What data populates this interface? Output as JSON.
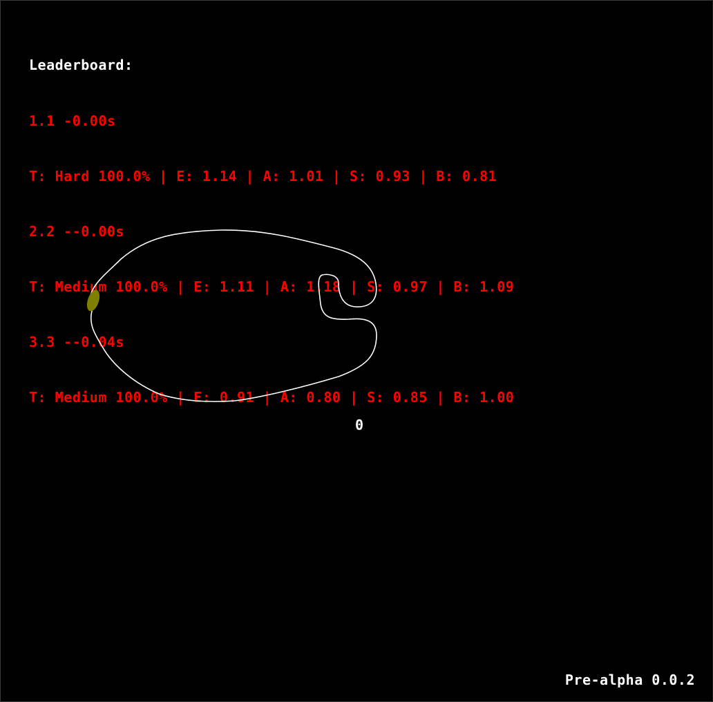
{
  "leaderboard": {
    "title": "Leaderboard:",
    "entries": [
      {
        "header": "1.1 -0.00s",
        "stats": "T: Hard 100.0% | E: 1.14 | A: 1.01 | S: 0.93 | B: 0.81"
      },
      {
        "header": "2.2 --0.00s",
        "stats": "T: Medium 100.0% | E: 1.11 | A: 1.18 | S: 0.97 | B: 1.09"
      },
      {
        "header": "3.3 --0.04s",
        "stats": "T: Medium 100.0% | E: 0.91 | A: 0.80 | S: 0.85 | B: 1.00"
      }
    ]
  },
  "lap_counter": "0",
  "version": "Pre-alpha 0.0.2",
  "colors": {
    "background": "#000000",
    "leaderboard_title": "#ffffff",
    "leaderboard_text": "#ff0000",
    "track_line": "#ffffff",
    "car": "#808000"
  }
}
